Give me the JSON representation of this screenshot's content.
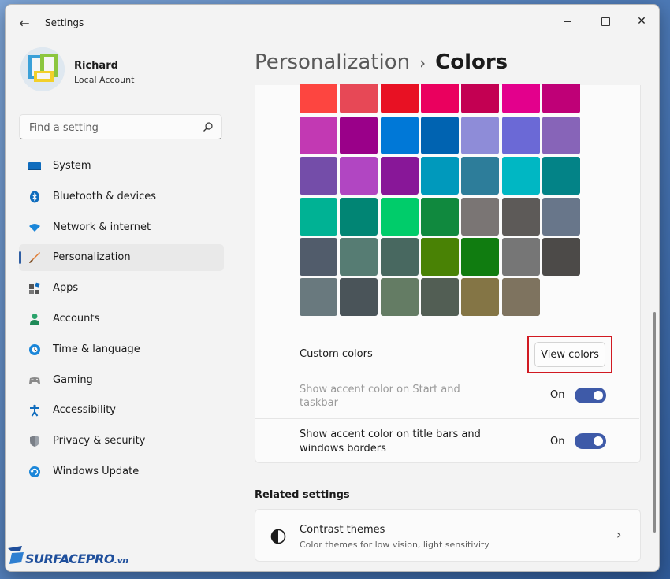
{
  "window": {
    "title": "Settings"
  },
  "profile": {
    "name": "Richard",
    "account_type": "Local Account"
  },
  "search": {
    "placeholder": "Find a setting"
  },
  "sidebar": {
    "items": [
      {
        "label": "System",
        "icon": "system-icon",
        "active": false
      },
      {
        "label": "Bluetooth & devices",
        "icon": "bluetooth-icon",
        "active": false
      },
      {
        "label": "Network & internet",
        "icon": "network-icon",
        "active": false
      },
      {
        "label": "Personalization",
        "icon": "brush-icon",
        "active": true
      },
      {
        "label": "Apps",
        "icon": "apps-icon",
        "active": false
      },
      {
        "label": "Accounts",
        "icon": "accounts-icon",
        "active": false
      },
      {
        "label": "Time & language",
        "icon": "globe-icon",
        "active": false
      },
      {
        "label": "Gaming",
        "icon": "gamepad-icon",
        "active": false
      },
      {
        "label": "Accessibility",
        "icon": "accessibility-icon",
        "active": false
      },
      {
        "label": "Privacy & security",
        "icon": "shield-icon",
        "active": false
      },
      {
        "label": "Windows Update",
        "icon": "update-icon",
        "active": false
      }
    ]
  },
  "breadcrumb": {
    "parent": "Personalization",
    "separator": "›",
    "current": "Colors"
  },
  "accent_colors": [
    [
      "#fd4540",
      "#e74856",
      "#e81123",
      "#ea005e",
      "#c30052",
      "#e3008c",
      "#bf0077"
    ],
    [
      "#c239b3",
      "#9a0089",
      "#0078d7",
      "#0063b1",
      "#8e8cd8",
      "#6b69d6",
      "#8764b8"
    ],
    [
      "#744da9",
      "#b146c2",
      "#881798",
      "#0099bc",
      "#2d7d9a",
      "#00b7c3",
      "#038387"
    ],
    [
      "#00b294",
      "#018574",
      "#00cc6a",
      "#10893e",
      "#7a7574",
      "#5d5a58",
      "#68768a"
    ],
    [
      "#515c6b",
      "#567c73",
      "#486860",
      "#498205",
      "#107c10",
      "#767676",
      "#4c4a48"
    ],
    [
      "#69797e",
      "#4a5459",
      "#647c64",
      "#525e54",
      "#847545",
      "#7e735f"
    ]
  ],
  "custom_colors": {
    "label": "Custom colors",
    "button": "View colors"
  },
  "toggles": [
    {
      "label_line1": "Show accent color on Start and",
      "label_line2": "taskbar",
      "state": "On",
      "disabled": true
    },
    {
      "label_line1": "Show accent color on title bars and",
      "label_line2": "windows borders",
      "state": "On",
      "disabled": false
    }
  ],
  "related": {
    "heading": "Related settings",
    "contrast_title": "Contrast themes",
    "contrast_subtitle": "Color themes for low vision, light sensitivity"
  },
  "watermark": {
    "brand": "SURFACEPRO",
    "suffix": ".vn"
  }
}
